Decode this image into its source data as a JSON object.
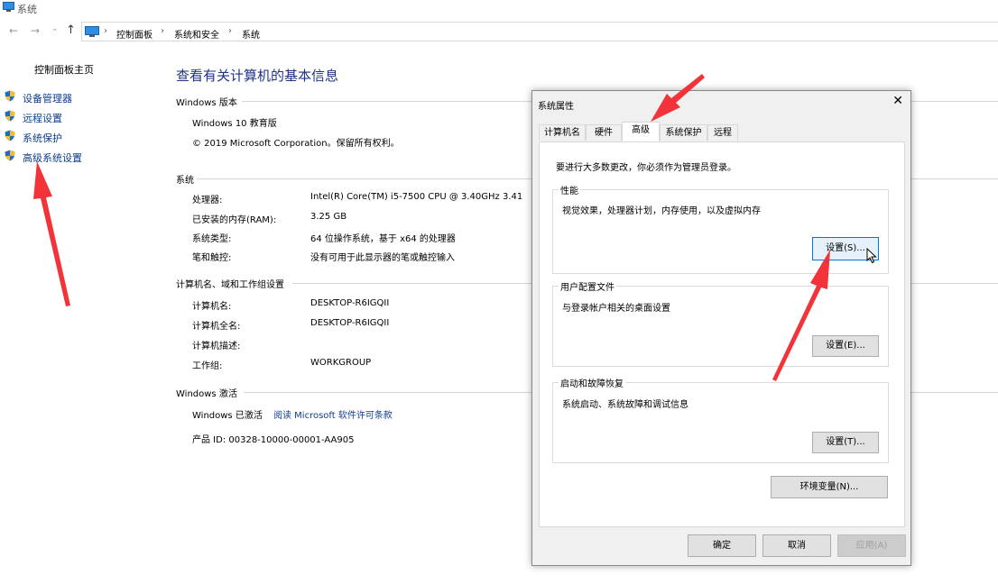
{
  "window": {
    "title": "系统"
  },
  "nav": {
    "breadcrumb": [
      "控制面板",
      "系统和安全",
      "系统"
    ]
  },
  "sidebar": {
    "home": "控制面板主页",
    "links": [
      "设备管理器",
      "远程设置",
      "系统保护",
      "高级系统设置"
    ]
  },
  "main": {
    "title": "查看有关计算机的基本信息",
    "edition": {
      "heading": "Windows 版本",
      "name": "Windows 10 教育版",
      "copyright": "© 2019 Microsoft Corporation。保留所有权利。"
    },
    "system": {
      "heading": "系统",
      "rows": [
        {
          "label": "处理器:",
          "value": "Intel(R) Core(TM) i5-7500 CPU @ 3.40GHz   3.41"
        },
        {
          "label": "已安装的内存(RAM):",
          "value": "3.25 GB"
        },
        {
          "label": "系统类型:",
          "value": "64 位操作系统，基于 x64 的处理器"
        },
        {
          "label": "笔和触控:",
          "value": "没有可用于此显示器的笔或触控输入"
        }
      ]
    },
    "computer": {
      "heading": "计算机名、域和工作组设置",
      "rows": [
        {
          "label": "计算机名:",
          "value": "DESKTOP-R6IGQII"
        },
        {
          "label": "计算机全名:",
          "value": "DESKTOP-R6IGQII"
        },
        {
          "label": "计算机描述:",
          "value": ""
        },
        {
          "label": "工作组:",
          "value": "WORKGROUP"
        }
      ]
    },
    "activation": {
      "heading": "Windows 激活",
      "status": "Windows 已激活",
      "link": "阅读 Microsoft 软件许可条款",
      "product_id": "产品 ID: 00328-10000-00001-AA905"
    }
  },
  "dialog": {
    "title": "系统属性",
    "close": "✕",
    "tabs": [
      "计算机名",
      "硬件",
      "高级",
      "系统保护",
      "远程"
    ],
    "active_tab": "高级",
    "admin_note": "要进行大多数更改，你必须作为管理员登录。",
    "performance": {
      "label": "性能",
      "desc": "视觉效果，处理器计划，内存使用，以及虚拟内存",
      "button": "设置(S)..."
    },
    "profiles": {
      "label": "用户配置文件",
      "desc": "与登录帐户相关的桌面设置",
      "button": "设置(E)..."
    },
    "startup": {
      "label": "启动和故障恢复",
      "desc": "系统启动、系统故障和调试信息",
      "button": "设置(T)..."
    },
    "env_button": "环境变量(N)...",
    "ok": "确定",
    "cancel": "取消",
    "apply": "应用(A)"
  },
  "colors": {
    "link": "#0d3d8c",
    "title": "#1e3287",
    "annotation_arrow": "#f2333a"
  },
  "icons": [
    "computer-icon",
    "back-arrow-icon",
    "forward-arrow-icon",
    "up-arrow-icon",
    "shield-icon",
    "close-icon",
    "cursor-icon"
  ]
}
